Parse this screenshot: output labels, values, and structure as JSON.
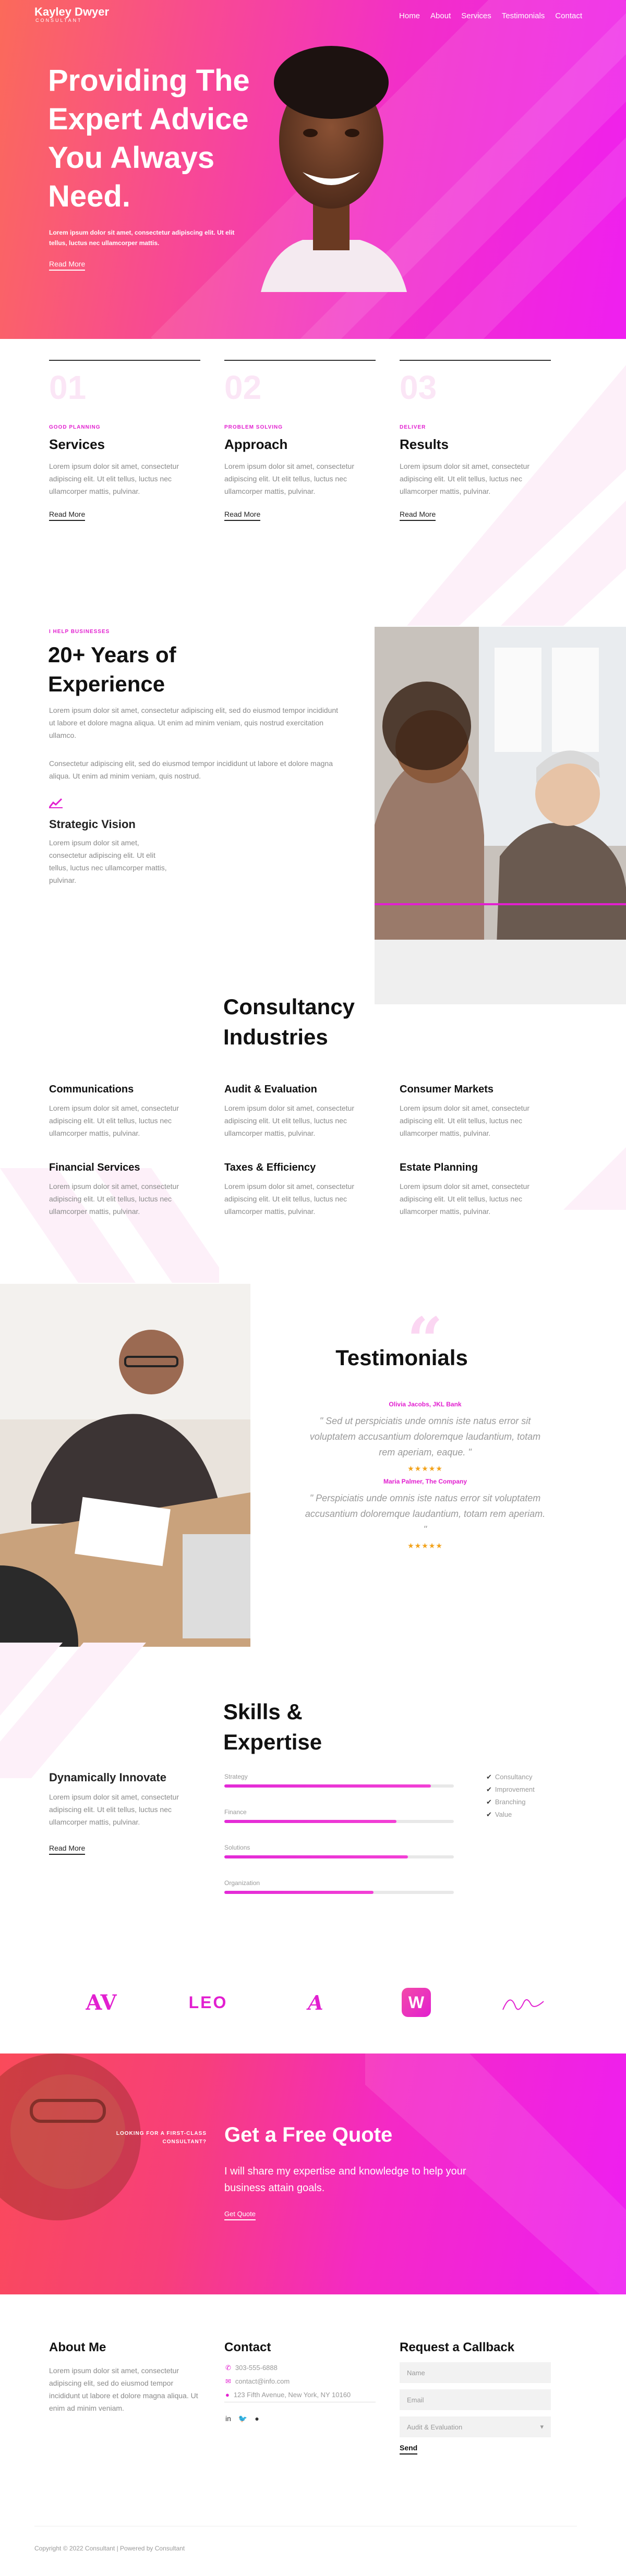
{
  "brand": {
    "name": "Kayley Dwyer",
    "tagline": "CONSULTANT"
  },
  "nav": [
    "Home",
    "About",
    "Services",
    "Testimonials",
    "Contact"
  ],
  "hero": {
    "title": "Providing The Expert Advice You Always Need.",
    "subtitle": "Lorem ipsum dolor sit amet, consectetur adipiscing elit. Ut elit tellus, luctus nec ullamcorper mattis.",
    "button": "Read More"
  },
  "features": [
    {
      "num": "01",
      "eyebrow": "GOOD PLANNING",
      "title": "Services",
      "text": "Lorem ipsum dolor sit amet, consectetur adipiscing elit. Ut elit tellus, luctus nec ullamcorper mattis, pulvinar.",
      "button": "Read More"
    },
    {
      "num": "02",
      "eyebrow": "PROBLEM SOLVING",
      "title": "Approach",
      "text": "Lorem ipsum dolor sit amet, consectetur adipiscing elit. Ut elit tellus, luctus nec ullamcorper mattis, pulvinar.",
      "button": "Read More"
    },
    {
      "num": "03",
      "eyebrow": "DELIVER",
      "title": "Results",
      "text": "Lorem ipsum dolor sit amet, consectetur adipiscing elit. Ut elit tellus, luctus nec ullamcorper mattis, pulvinar.",
      "button": "Read More"
    }
  ],
  "experience": {
    "eyebrow": "I HELP BUSINESSES",
    "title": "20+ Years of Experience",
    "p1": "Lorem ipsum dolor sit amet, consectetur adipiscing elit, sed do eiusmod tempor incididunt ut labore et dolore magna aliqua. Ut enim ad minim veniam, quis nostrud exercitation ullamco.",
    "p2": "Consectetur adipiscing elit, sed do eiusmod tempor incididunt ut labore et dolore magna aliqua. Ut enim ad minim veniam, quis nostrud.",
    "vision_title": "Strategic Vision",
    "vision_text": "Lorem ipsum dolor sit amet, consectetur adipiscing elit. Ut elit tellus, luctus nec ullamcorper mattis, pulvinar."
  },
  "consultancy": {
    "title": "Consultancy Industries",
    "items": [
      {
        "title": "Communications",
        "text": "Lorem ipsum dolor sit amet, consectetur adipiscing elit. Ut elit tellus, luctus nec ullamcorper mattis, pulvinar."
      },
      {
        "title": "Audit & Evaluation",
        "text": "Lorem ipsum dolor sit amet, consectetur adipiscing elit. Ut elit tellus, luctus nec ullamcorper mattis, pulvinar."
      },
      {
        "title": "Consumer Markets",
        "text": "Lorem ipsum dolor sit amet, consectetur adipiscing elit. Ut elit tellus, luctus nec ullamcorper mattis, pulvinar."
      },
      {
        "title": "Financial Services",
        "text": "Lorem ipsum dolor sit amet, consectetur adipiscing elit. Ut elit tellus, luctus nec ullamcorper mattis, pulvinar."
      },
      {
        "title": "Taxes & Efficiency",
        "text": "Lorem ipsum dolor sit amet, consectetur adipiscing elit. Ut elit tellus, luctus nec ullamcorper mattis, pulvinar."
      },
      {
        "title": "Estate Planning",
        "text": "Lorem ipsum dolor sit amet, consectetur adipiscing elit. Ut elit tellus, luctus nec ullamcorper mattis, pulvinar."
      }
    ]
  },
  "testimonials": {
    "title": "Testimonials",
    "items": [
      {
        "who": "Olivia Jacobs, JKL Bank",
        "quote": "\" Sed ut perspiciatis unde omnis iste natus error sit voluptatem accusantium doloremque laudantium, totam rem aperiam, eaque. \"",
        "stars": "★★★★★",
        "rating": 5
      },
      {
        "who": "Maria Palmer, The Company",
        "quote": "\" Perspiciatis unde omnis iste natus error sit voluptatem accusantium doloremque laudantium, totam rem aperiam. \"",
        "stars": "★★★★★",
        "rating": 5
      }
    ]
  },
  "skills": {
    "title": "Skills & Expertise",
    "side_title": "Dynamically Innovate",
    "side_text": "Lorem ipsum dolor sit amet, consectetur adipiscing elit. Ut elit tellus, luctus nec ullamcorper mattis, pulvinar.",
    "button": "Read More",
    "bars": [
      {
        "label": "Strategy",
        "value": 0.9
      },
      {
        "label": "Finance",
        "value": 0.75
      },
      {
        "label": "Solutions",
        "value": 0.8
      },
      {
        "label": "Organization",
        "value": 0.65
      }
    ],
    "checks": [
      "Consultancy",
      "Improvement",
      "Branching",
      "Value"
    ]
  },
  "logos": [
    "AV",
    "LEO",
    "A",
    "W",
    "signature"
  ],
  "quote": {
    "small": "LOOKING FOR A FIRST-CLASS CONSULTANT?",
    "title": "Get a Free Quote",
    "subtitle": "I will share my expertise and knowledge to help your business attain goals.",
    "button": "Get Quote"
  },
  "footer": {
    "about_title": "About Me",
    "about_text": "Lorem ipsum dolor sit amet, consectetur adipiscing elit, sed do eiusmod tempor incididunt ut labore et dolore magna aliqua. Ut enim ad minim veniam.",
    "contact_title": "Contact",
    "phone": "303-555-6888",
    "email": "contact@info.com",
    "address": "123 Fifth Avenue, New York, NY 10160",
    "callback_title": "Request a Callback",
    "name_placeholder": "Name",
    "email_placeholder": "Email",
    "select_value": "Audit & Evaluation",
    "send": "Send",
    "copyright": "Copyright © 2022 Consultant | Powered by Consultant"
  },
  "colors": {
    "accent": "#e21fd0",
    "hero_start": "#fb6a5a",
    "hero_end": "#ef1ff0",
    "star": "#f2a21a"
  }
}
